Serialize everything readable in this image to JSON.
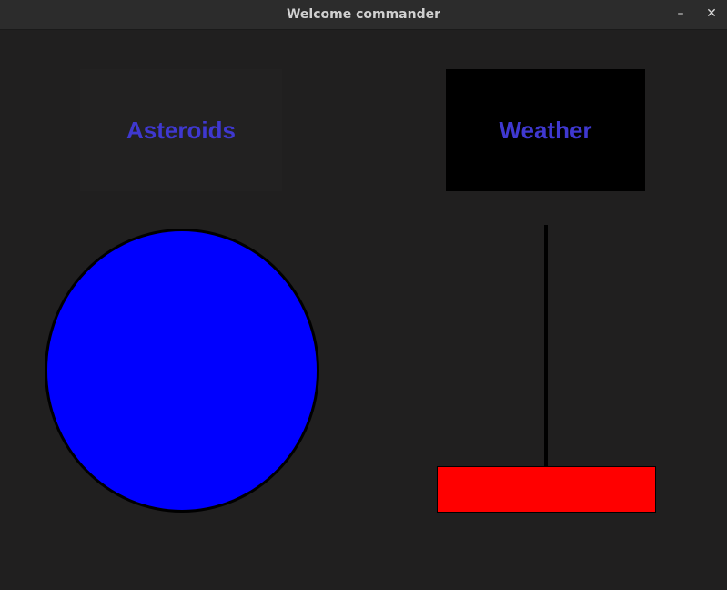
{
  "window": {
    "title": "Welcome commander",
    "minimize_glyph": "–",
    "close_glyph": "✕"
  },
  "tiles": {
    "asteroids_label": "Asteroids",
    "weather_label": "Weather"
  },
  "colors": {
    "tile_text": "#3f38d0",
    "circle_fill": "#0000ff",
    "bar_fill": "#ff0000",
    "pole": "#000000",
    "background": "#201f1f"
  },
  "icons": {
    "minimize": "minimize-icon",
    "close": "close-icon"
  }
}
